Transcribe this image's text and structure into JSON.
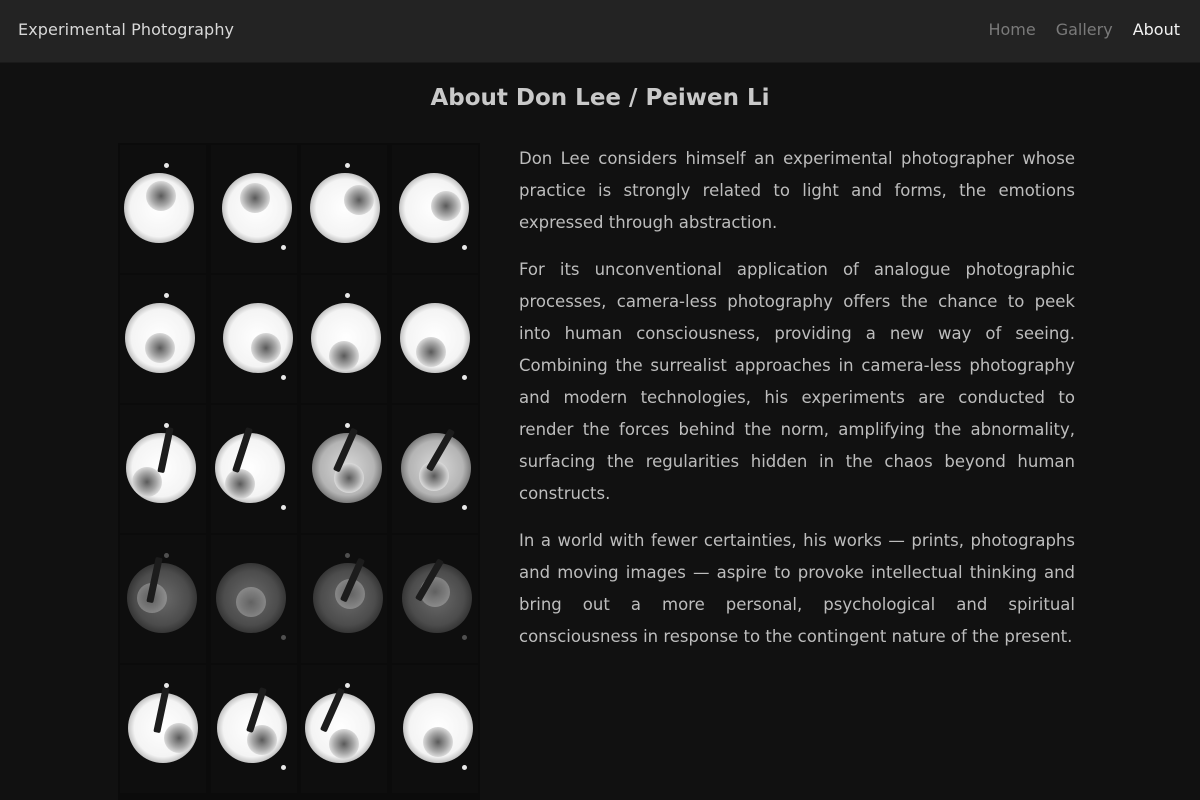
{
  "navbar": {
    "brand": "Experimental Photography",
    "links": [
      {
        "label": "Home",
        "active": false
      },
      {
        "label": "Gallery",
        "active": false
      },
      {
        "label": "About",
        "active": true
      }
    ]
  },
  "main": {
    "title": "About Don Lee / Peiwen Li",
    "paragraphs": [
      "Don Lee considers himself an experimental photographer whose practice is strongly related to light and forms, the emotions expressed through abstraction.",
      "For its unconventional application of analogue photographic processes, camera-less photography offers the chance to peek into human consciousness, providing a new way of seeing. Combining the surrealist approaches in camera-less photography and modern technologies, his experiments are conducted to render the forces behind the norm, amplifying the abnormality, surfacing the regularities hidden in the chaos beyond human constructs.",
      "In a world with fewer certainties, his works — prints, photographs and moving images — aspire to provoke intellectual thinking and bring out a more personal, psychological and spiritual consciousness in response to the contingent nature of the present."
    ]
  },
  "colors": {
    "background": "#111111",
    "navbar": "#232323",
    "nav_inactive": "#7a7a7a",
    "nav_active": "#f2f2f2",
    "text": "#bdbdbd"
  },
  "contact_sheet": {
    "rows": 5,
    "columns": 4,
    "frames": [
      {
        "tone": "bright",
        "stem": false
      },
      {
        "tone": "bright",
        "stem": false
      },
      {
        "tone": "bright",
        "stem": false
      },
      {
        "tone": "bright",
        "stem": false
      },
      {
        "tone": "bright",
        "stem": false
      },
      {
        "tone": "bright",
        "stem": false
      },
      {
        "tone": "bright",
        "stem": false
      },
      {
        "tone": "bright",
        "stem": false
      },
      {
        "tone": "bright",
        "stem": true
      },
      {
        "tone": "bright",
        "stem": true
      },
      {
        "tone": "mid",
        "stem": true
      },
      {
        "tone": "mid",
        "stem": true
      },
      {
        "tone": "dim",
        "stem": true
      },
      {
        "tone": "dim",
        "stem": false
      },
      {
        "tone": "dim",
        "stem": true
      },
      {
        "tone": "dim",
        "stem": true
      },
      {
        "tone": "bright",
        "stem": true
      },
      {
        "tone": "bright",
        "stem": true
      },
      {
        "tone": "bright",
        "stem": true
      },
      {
        "tone": "bright",
        "stem": false
      }
    ]
  }
}
